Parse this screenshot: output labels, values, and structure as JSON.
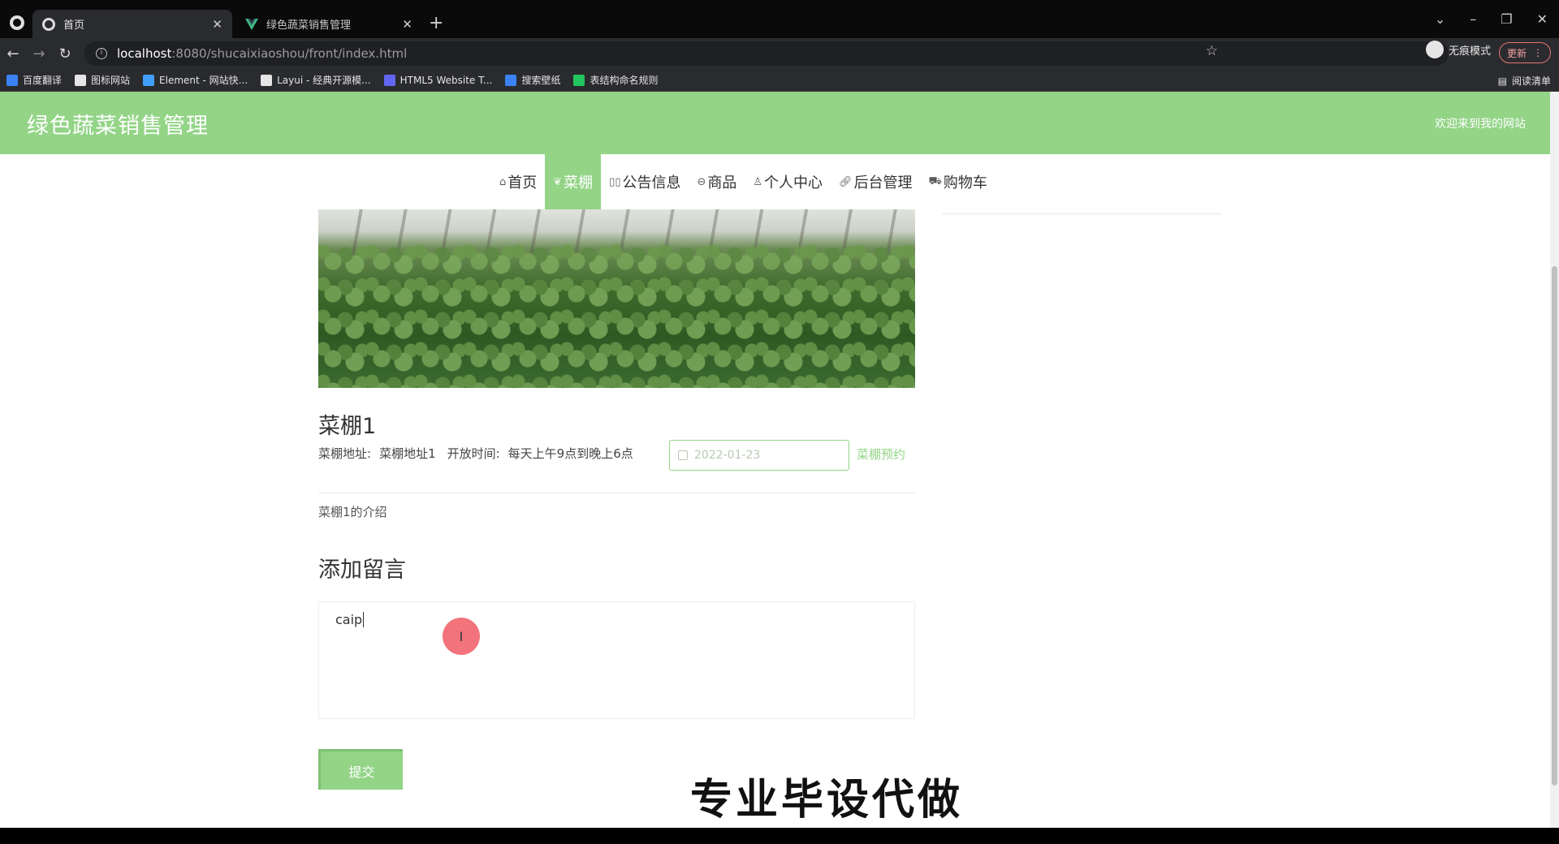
{
  "browser": {
    "tabs": [
      {
        "title": "首页",
        "active": true
      },
      {
        "title": "绿色蔬菜销售管理",
        "active": false
      }
    ],
    "url_host": "localhost",
    "url_path": ":8080/shucaixiaoshou/front/index.html",
    "incognito_label": "无痕模式",
    "update_label": "更新",
    "bookmarks": [
      {
        "label": "百度翻译",
        "color": "#3b82f6"
      },
      {
        "label": "图标网站",
        "color": "#e5e5e5"
      },
      {
        "label": "Element - 网站快...",
        "color": "#409eff"
      },
      {
        "label": "Layui - 经典开源模...",
        "color": "#e5e5e5"
      },
      {
        "label": "HTML5 Website T...",
        "color": "#6366f1"
      },
      {
        "label": "搜索壁纸",
        "color": "#3b82f6"
      },
      {
        "label": "表结构命名规则",
        "color": "#22c55e"
      }
    ],
    "reading_list": "阅读清单"
  },
  "site": {
    "title": "绿色蔬菜销售管理",
    "welcome": "欢迎来到我的网站",
    "accent_color": "#93d487"
  },
  "nav": {
    "items": [
      {
        "label": "首页",
        "icon": "home-icon",
        "active": false
      },
      {
        "label": "菜棚",
        "icon": "leaf-icon",
        "active": true
      },
      {
        "label": "公告信息",
        "icon": "notice-icon",
        "active": false
      },
      {
        "label": "商品",
        "icon": "goods-icon",
        "active": false
      },
      {
        "label": "个人中心",
        "icon": "user-icon",
        "active": false
      },
      {
        "label": "后台管理",
        "icon": "link-icon",
        "active": false
      },
      {
        "label": "购物车",
        "icon": "cart-icon",
        "active": false
      }
    ]
  },
  "detail": {
    "title": "菜棚1",
    "address_label": "菜棚地址:",
    "address_value": "菜棚地址1",
    "open_time_label": "开放时间:",
    "open_time_value": "每天上午9点到晚上6点",
    "date_placeholder": "2022-01-23",
    "reserve_label": "菜棚预约",
    "intro": "菜棚1的介绍"
  },
  "message": {
    "title": "添加留言",
    "input_value": "caip",
    "submit_label": "提交"
  },
  "watermark": "专业毕设代做"
}
